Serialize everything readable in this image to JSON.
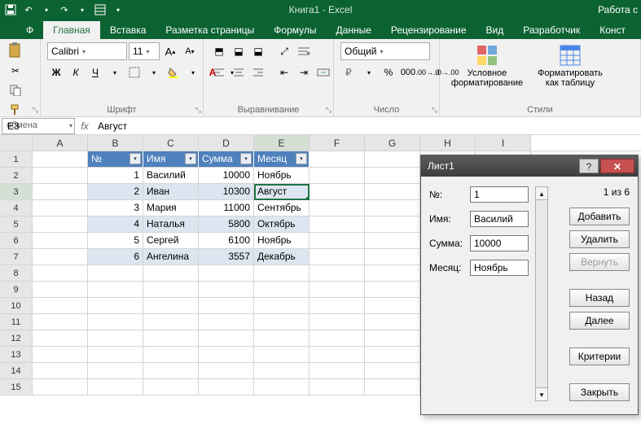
{
  "app": {
    "title": "Книга1 - Excel",
    "right": "Работа с"
  },
  "tabs": {
    "file": "Ф",
    "home": "Главная",
    "insert": "Вставка",
    "layout": "Разметка страницы",
    "formulas": "Формулы",
    "data_t": "Данные",
    "review": "Рецензирование",
    "view": "Вид",
    "developer": "Разработчик",
    "construct": "Конст"
  },
  "ribbon": {
    "clipboard": {
      "label": "обмена"
    },
    "font": {
      "label": "Шрифт",
      "name": "Calibri",
      "size": "11",
      "bold": "Ж",
      "italic": "К",
      "underline": "Ч"
    },
    "align": {
      "label": "Выравнивание"
    },
    "number": {
      "label": "Число",
      "format": "Общий"
    },
    "styles": {
      "label": "Стили",
      "cond": "Условное форматирование",
      "table": "Форматировать как таблицу"
    }
  },
  "fbar": {
    "ref": "E3",
    "formula": "Август"
  },
  "cols": [
    "A",
    "B",
    "C",
    "D",
    "E",
    "F",
    "G",
    "H",
    "I"
  ],
  "rows": [
    "1",
    "2",
    "3",
    "4",
    "5",
    "6",
    "7",
    "8",
    "9",
    "10",
    "11",
    "12",
    "13",
    "14",
    "15"
  ],
  "table": {
    "headers": {
      "no": "№",
      "name": "Имя",
      "sum": "Сумма",
      "month": "Месяц"
    },
    "rows": [
      {
        "no": "1",
        "name": "Василий",
        "sum": "10000",
        "month": "Ноябрь"
      },
      {
        "no": "2",
        "name": "Иван",
        "sum": "10300",
        "month": "Август"
      },
      {
        "no": "3",
        "name": "Мария",
        "sum": "11000",
        "month": "Сентябрь"
      },
      {
        "no": "4",
        "name": "Наталья",
        "sum": "5800",
        "month": "Октябрь"
      },
      {
        "no": "5",
        "name": "Сергей",
        "sum": "6100",
        "month": "Ноябрь"
      },
      {
        "no": "6",
        "name": "Ангелина",
        "sum": "3557",
        "month": "Декабрь"
      }
    ]
  },
  "form": {
    "title": "Лист1",
    "counter": "1 из 6",
    "labels": {
      "no": "№:",
      "name": "Имя:",
      "sum": "Сумма:",
      "month": "Месяц:"
    },
    "values": {
      "no": "1",
      "name": "Василий",
      "sum": "10000",
      "month": "Ноябрь"
    },
    "buttons": {
      "add": "Добавить",
      "delete": "Удалить",
      "restore": "Вернуть",
      "prev": "Назад",
      "next": "Далее",
      "criteria": "Критерии",
      "close": "Закрыть"
    }
  }
}
